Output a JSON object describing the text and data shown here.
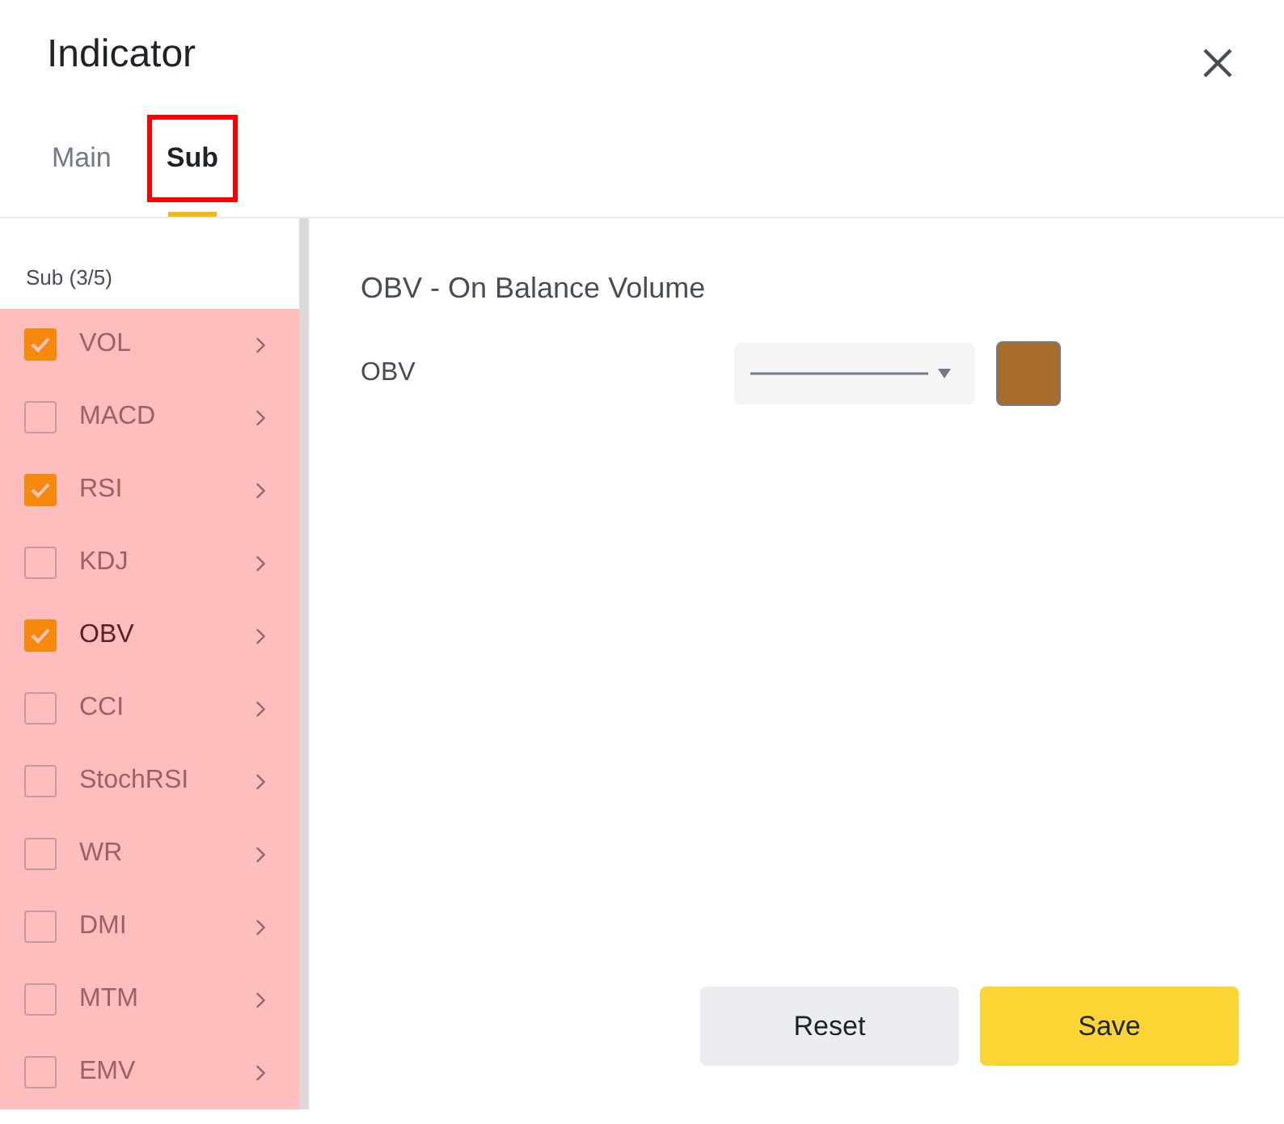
{
  "window": {
    "title": "Indicator"
  },
  "tabs": [
    {
      "label": "Main",
      "selected": false,
      "annotated": false
    },
    {
      "label": "Sub",
      "selected": true,
      "annotated": true
    }
  ],
  "sidebar": {
    "header": "Sub (3/5)",
    "highlighted": true,
    "items": [
      {
        "label": "VOL",
        "checked": true,
        "selected": false
      },
      {
        "label": "MACD",
        "checked": false,
        "selected": false
      },
      {
        "label": "RSI",
        "checked": true,
        "selected": false
      },
      {
        "label": "KDJ",
        "checked": false,
        "selected": false
      },
      {
        "label": "OBV",
        "checked": true,
        "selected": true
      },
      {
        "label": "CCI",
        "checked": false,
        "selected": false
      },
      {
        "label": "StochRSI",
        "checked": false,
        "selected": false
      },
      {
        "label": "WR",
        "checked": false,
        "selected": false
      },
      {
        "label": "DMI",
        "checked": false,
        "selected": false
      },
      {
        "label": "MTM",
        "checked": false,
        "selected": false
      },
      {
        "label": "EMV",
        "checked": false,
        "selected": false
      }
    ]
  },
  "detail": {
    "title": "OBV - On Balance Volume",
    "lines": [
      {
        "label": "OBV",
        "color": "#a86c2c"
      }
    ]
  },
  "buttons": [
    {
      "label": "Reset",
      "kind": "secondary"
    },
    {
      "label": "Save",
      "kind": "primary"
    }
  ]
}
